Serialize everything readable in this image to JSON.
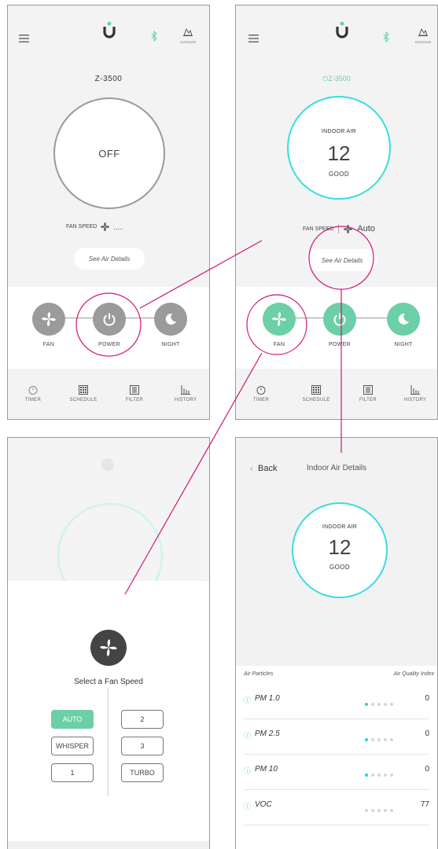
{
  "colors": {
    "accent_green": "#6ccfa6",
    "accent_cyan": "#37dede",
    "annotation": "#d1147a",
    "gray_button": "#9b9b9b"
  },
  "screen1": {
    "device_name": "Z-3500",
    "power_state": "OFF",
    "outdoor_label": "OUTDOOR",
    "fan_speed_label": "FAN SPEED",
    "fan_speed_value": ".....",
    "air_details_button": "See Air Details",
    "buttons": [
      {
        "label": "FAN",
        "icon": "fan-icon"
      },
      {
        "label": "POWER",
        "icon": "power-icon"
      },
      {
        "label": "NIGHT",
        "icon": "moon-icon"
      }
    ],
    "tabs": [
      {
        "label": "TIMER",
        "icon": "timer-icon"
      },
      {
        "label": "SCHEDULE",
        "icon": "calendar-icon"
      },
      {
        "label": "FILTER",
        "icon": "filter-icon"
      },
      {
        "label": "HISTORY",
        "icon": "history-icon"
      }
    ]
  },
  "screen2": {
    "device_name": "Z-3500",
    "outdoor_label": "OUTDOOR",
    "indoor_label": "INDOOR AIR",
    "aqi": "12",
    "quality": "GOOD",
    "fan_speed_label": "FAN SPEED",
    "fan_speed_value": "Auto",
    "air_details_button": "See Air Details",
    "buttons": [
      {
        "label": "FAN",
        "icon": "fan-icon"
      },
      {
        "label": "POWER",
        "icon": "power-icon"
      },
      {
        "label": "NIGHT",
        "icon": "moon-icon"
      }
    ],
    "tabs": [
      {
        "label": "TIMER",
        "icon": "timer-icon"
      },
      {
        "label": "SCHEDULE",
        "icon": "calendar-icon"
      },
      {
        "label": "FILTER",
        "icon": "filter-icon"
      },
      {
        "label": "HISTORY",
        "icon": "history-icon"
      }
    ]
  },
  "screen3": {
    "prompt": "Select a Fan Speed",
    "left_options": [
      "AUTO",
      "WHISPER",
      "1"
    ],
    "right_options": [
      "2",
      "3",
      "TURBO"
    ],
    "selected": "AUTO"
  },
  "screen4": {
    "back_label": "Back",
    "title": "Indoor Air Details",
    "indoor_label": "INDOOR AIR",
    "aqi": "12",
    "quality": "GOOD",
    "col_left": "Air Particles",
    "col_right": "Air Quality Index",
    "rows": [
      {
        "name": "PM 1.0",
        "value": "0",
        "active_dots": 1
      },
      {
        "name": "PM 2.5",
        "value": "0",
        "active_dots": 1
      },
      {
        "name": "PM 10",
        "value": "0",
        "active_dots": 1
      },
      {
        "name": "VOC",
        "value": "77",
        "active_dots": 0
      }
    ]
  }
}
